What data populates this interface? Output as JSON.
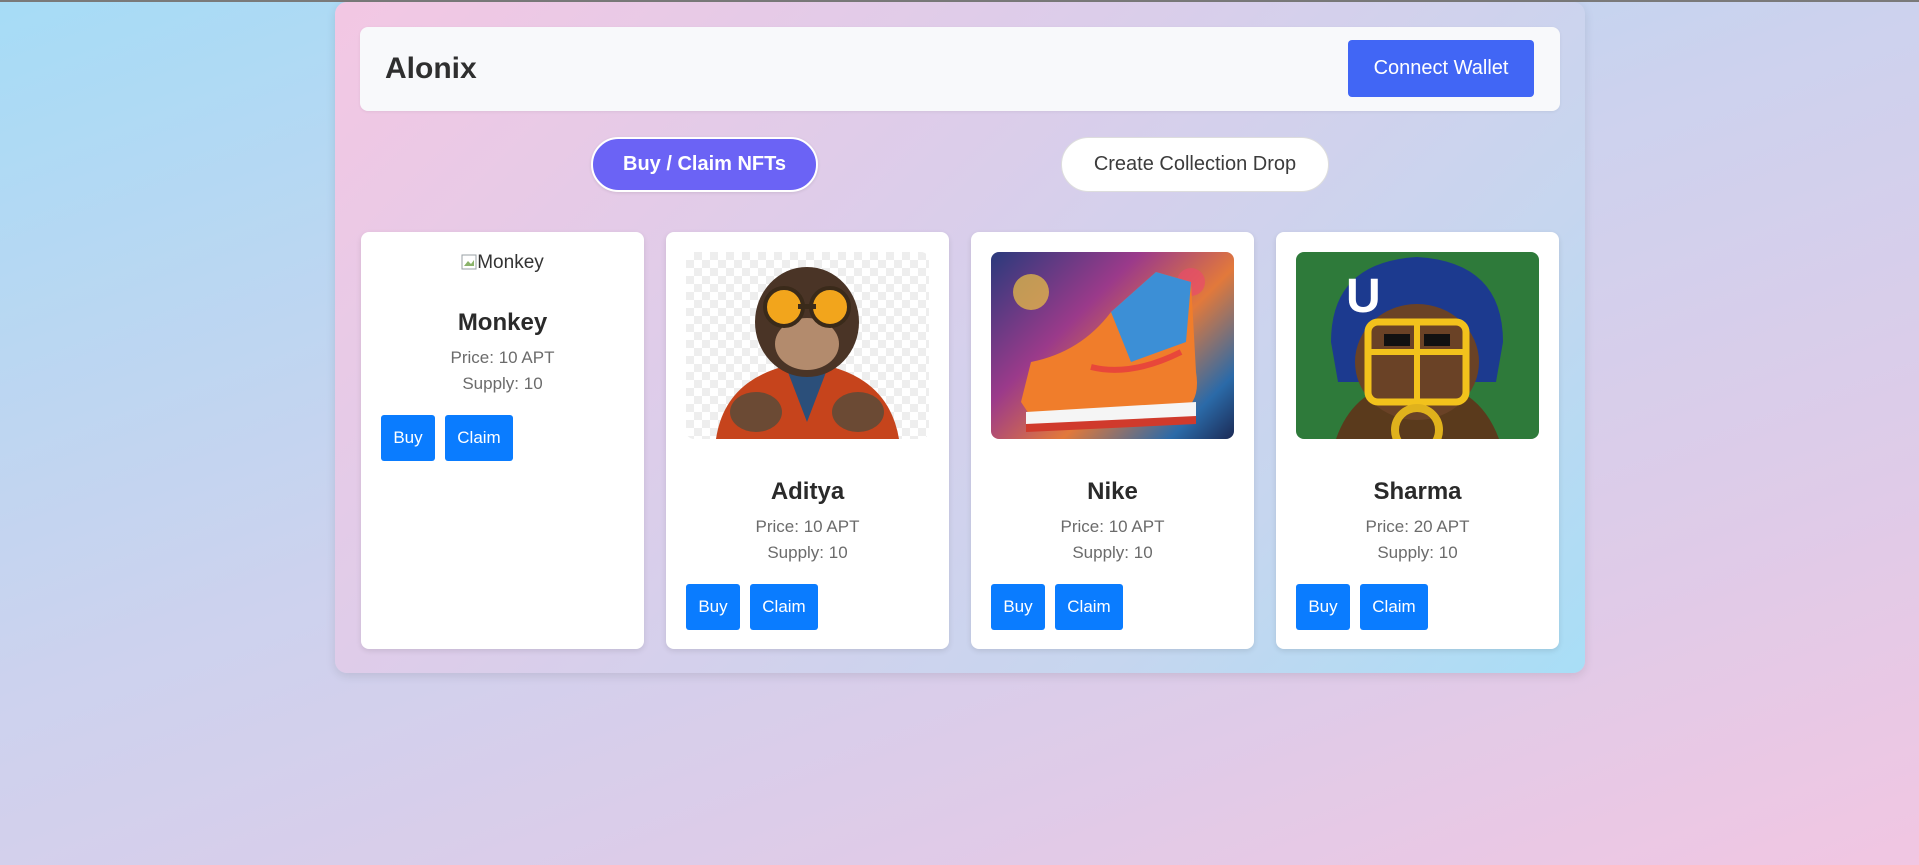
{
  "app": {
    "brand": "Alonix",
    "connect_label": "Connect Wallet"
  },
  "tabs": {
    "buy_label": "Buy / Claim NFTs",
    "create_label": "Create Collection Drop"
  },
  "nfts": [
    {
      "name": "Monkey",
      "image_alt": "Monkey",
      "price": "Price: 10 APT",
      "supply": "Supply: 10",
      "buy": "Buy",
      "claim": "Claim"
    },
    {
      "name": "Aditya",
      "price": "Price: 10 APT",
      "supply": "Supply: 10",
      "buy": "Buy",
      "claim": "Claim"
    },
    {
      "name": "Nike",
      "price": "Price: 10 APT",
      "supply": "Supply: 10",
      "buy": "Buy",
      "claim": "Claim"
    },
    {
      "name": "Sharma",
      "price": "Price: 20 APT",
      "supply": "Supply: 10",
      "buy": "Buy",
      "claim": "Claim"
    }
  ],
  "colors": {
    "primary": "#4166f5",
    "tab_active": "#6b63f5",
    "card_button": "#0a7cff"
  }
}
